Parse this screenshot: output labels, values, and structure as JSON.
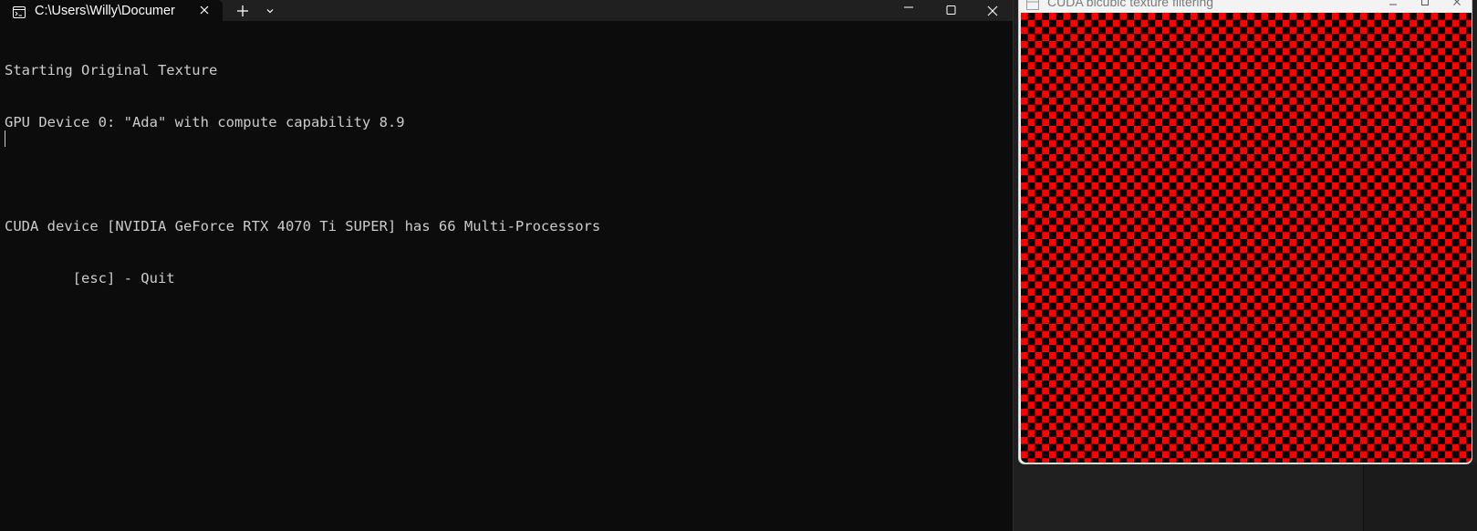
{
  "terminal": {
    "tab_title": "C:\\Users\\Willy\\Documer",
    "tab_icon": "console-icon",
    "new_tab_label": "+",
    "lines": [
      "Starting Original Texture",
      "GPU Device 0: \"Ada\" with compute capability 8.9",
      "",
      "CUDA device [NVIDIA GeForce RTX 4070 Ti SUPER] has 66 Multi-Processors",
      "        [esc] - Quit"
    ],
    "colors": {
      "background": "#0c0c0c",
      "text": "#cccccc",
      "titlebar": "#202020"
    }
  },
  "cuda_window": {
    "title": "CUDA bicubic texture filtering",
    "canvas": {
      "pattern": "checkerboard",
      "color_a": "#ff0000",
      "color_b": "#000000"
    }
  }
}
